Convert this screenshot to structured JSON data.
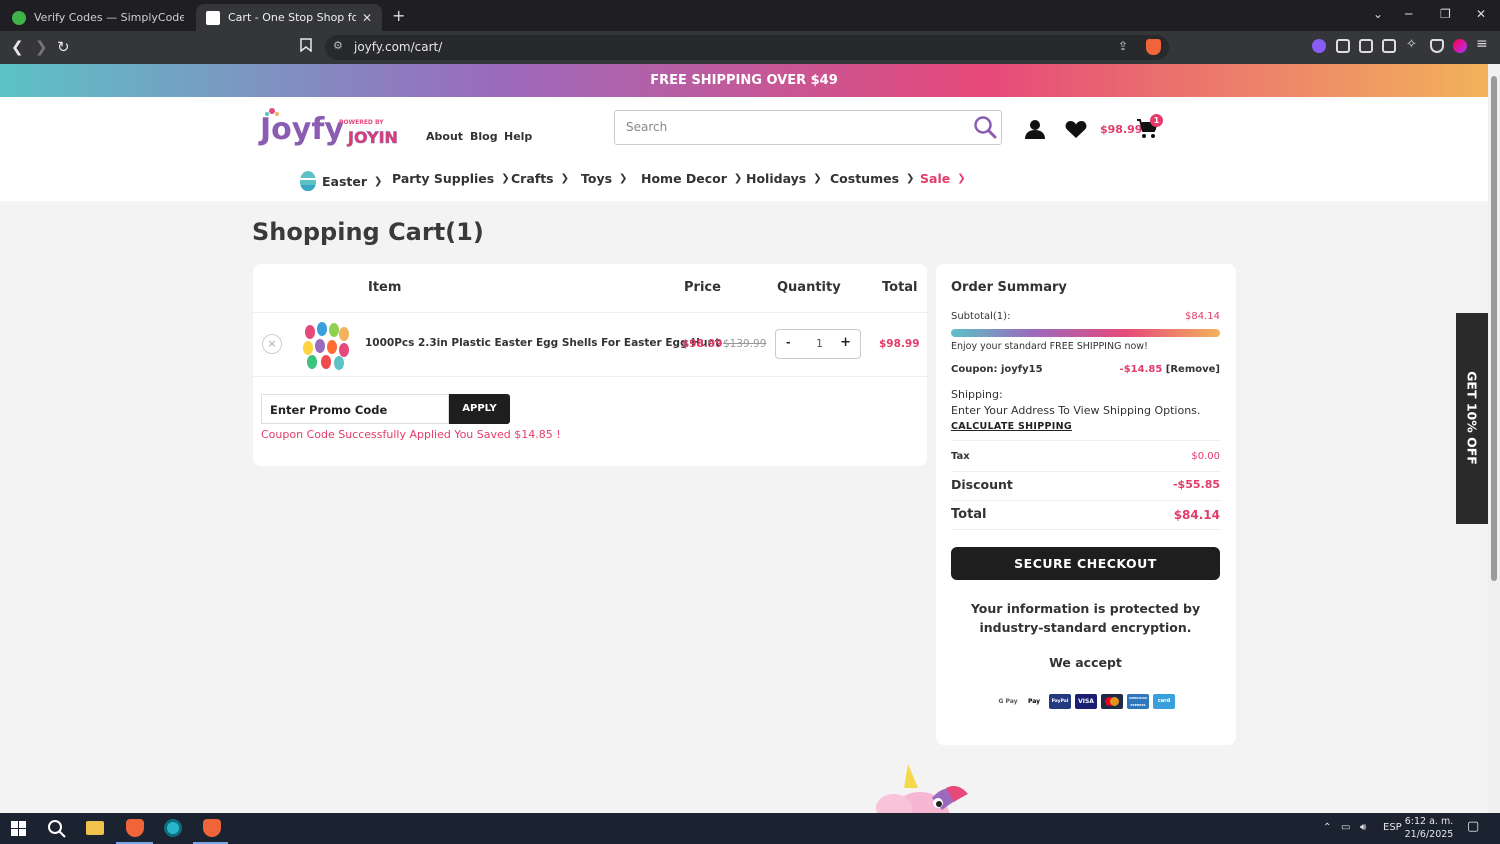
{
  "browser": {
    "tabs": [
      {
        "title": "Verify Codes — SimplyCodes",
        "active": false
      },
      {
        "title": "Cart - One Stop Shop for All Cele",
        "active": true
      }
    ],
    "url": "joyfy.com/cart/",
    "icons": [
      "back-icon",
      "forward-icon",
      "reload-icon",
      "bookmark-icon",
      "share-icon",
      "brave-shield-icon",
      "extensions-icon",
      "sidebar-icon",
      "wallet-icon",
      "leo-icon",
      "vpn-icon",
      "menu-icon"
    ]
  },
  "promo_banner": {
    "text": "FREE SHIPPING OVER $49"
  },
  "header": {
    "logo": {
      "text": "Joyfy",
      "tagline": "POWERED BY",
      "brand": "JOYIN"
    },
    "links": [
      "About",
      "Blog",
      "Help"
    ],
    "search_placeholder": "Search",
    "cart_price": "$98.99",
    "cart_count": "1"
  },
  "menu": [
    {
      "label": "Easter"
    },
    {
      "label": "Party Supplies"
    },
    {
      "label": "Crafts"
    },
    {
      "label": "Toys"
    },
    {
      "label": "Home Decor"
    },
    {
      "label": "Holidays"
    },
    {
      "label": "Costumes"
    },
    {
      "label": "Sale"
    }
  ],
  "page_title": "Shopping Cart(1)",
  "cart": {
    "headers": {
      "item": "Item",
      "price": "Price",
      "quantity": "Quantity",
      "total": "Total"
    },
    "items": [
      {
        "name": "1000Pcs 2.3in Plastic Easter Egg Shells For Easter Egg Hunt",
        "price": "$98.99",
        "old_price": "$139.99",
        "quantity": "1",
        "total": "$98.99",
        "remove_symbol": "×",
        "minus": "-",
        "plus": "+"
      }
    ],
    "promo_value": "Enter Promo Code",
    "apply_label": "APPLY",
    "coupon_message": "Coupon Code Successfully Applied You Saved $14.85 !"
  },
  "summary": {
    "title": "Order Summary",
    "subtotal_label": "Subtotal(1):",
    "subtotal_value": "$84.14",
    "free_shipping_progress": 1.0,
    "free_shipping_msg": "Enjoy your standard FREE SHIPPING now!",
    "coupon_label": "Coupon: joyfy15",
    "coupon_value": "-$14.85",
    "coupon_remove": "[Remove]",
    "shipping_label": "Shipping:",
    "shipping_msg": "Enter Your Address To View Shipping Options.",
    "calc_shipping": "CALCULATE SHIPPING",
    "tax_label": "Tax",
    "tax_value": "$0.00",
    "discount_label": "Discount",
    "discount_value": "-$55.85",
    "total_label": "Total",
    "total_value": "$84.14",
    "checkout_label": "SECURE CHECKOUT",
    "secure_line1": "Your information is protected by",
    "secure_line2": "industry-standard encryption.",
    "we_accept": "We accept",
    "payments": [
      {
        "name": "G Pay",
        "bg": "#ffffff",
        "fg": "#555555"
      },
      {
        "name": "Pay",
        "bg": "#ffffff",
        "fg": "#000000"
      },
      {
        "name": "PayPal",
        "bg": "#253b80",
        "fg": "#ffffff"
      },
      {
        "name": "VISA",
        "bg": "#1a1f71",
        "fg": "#ffffff"
      },
      {
        "name": "mastercard",
        "bg": "#1e2a46",
        "fg": "#ffffff"
      },
      {
        "name": "AMERICAN EXPRESS",
        "bg": "#2e77bc",
        "fg": "#ffffff"
      },
      {
        "name": "card",
        "bg": "#3aa0dd",
        "fg": "#ffffff"
      }
    ]
  },
  "side_tab": {
    "label": "GET 10% OFF"
  },
  "taskbar": {
    "language": "ESP",
    "time": "6:12 a. m.",
    "date": "21/6/2025"
  },
  "colors": {
    "accent": "#e33c6a",
    "dark": "#1e1e1e",
    "page_bg": "#f3f3f3"
  }
}
